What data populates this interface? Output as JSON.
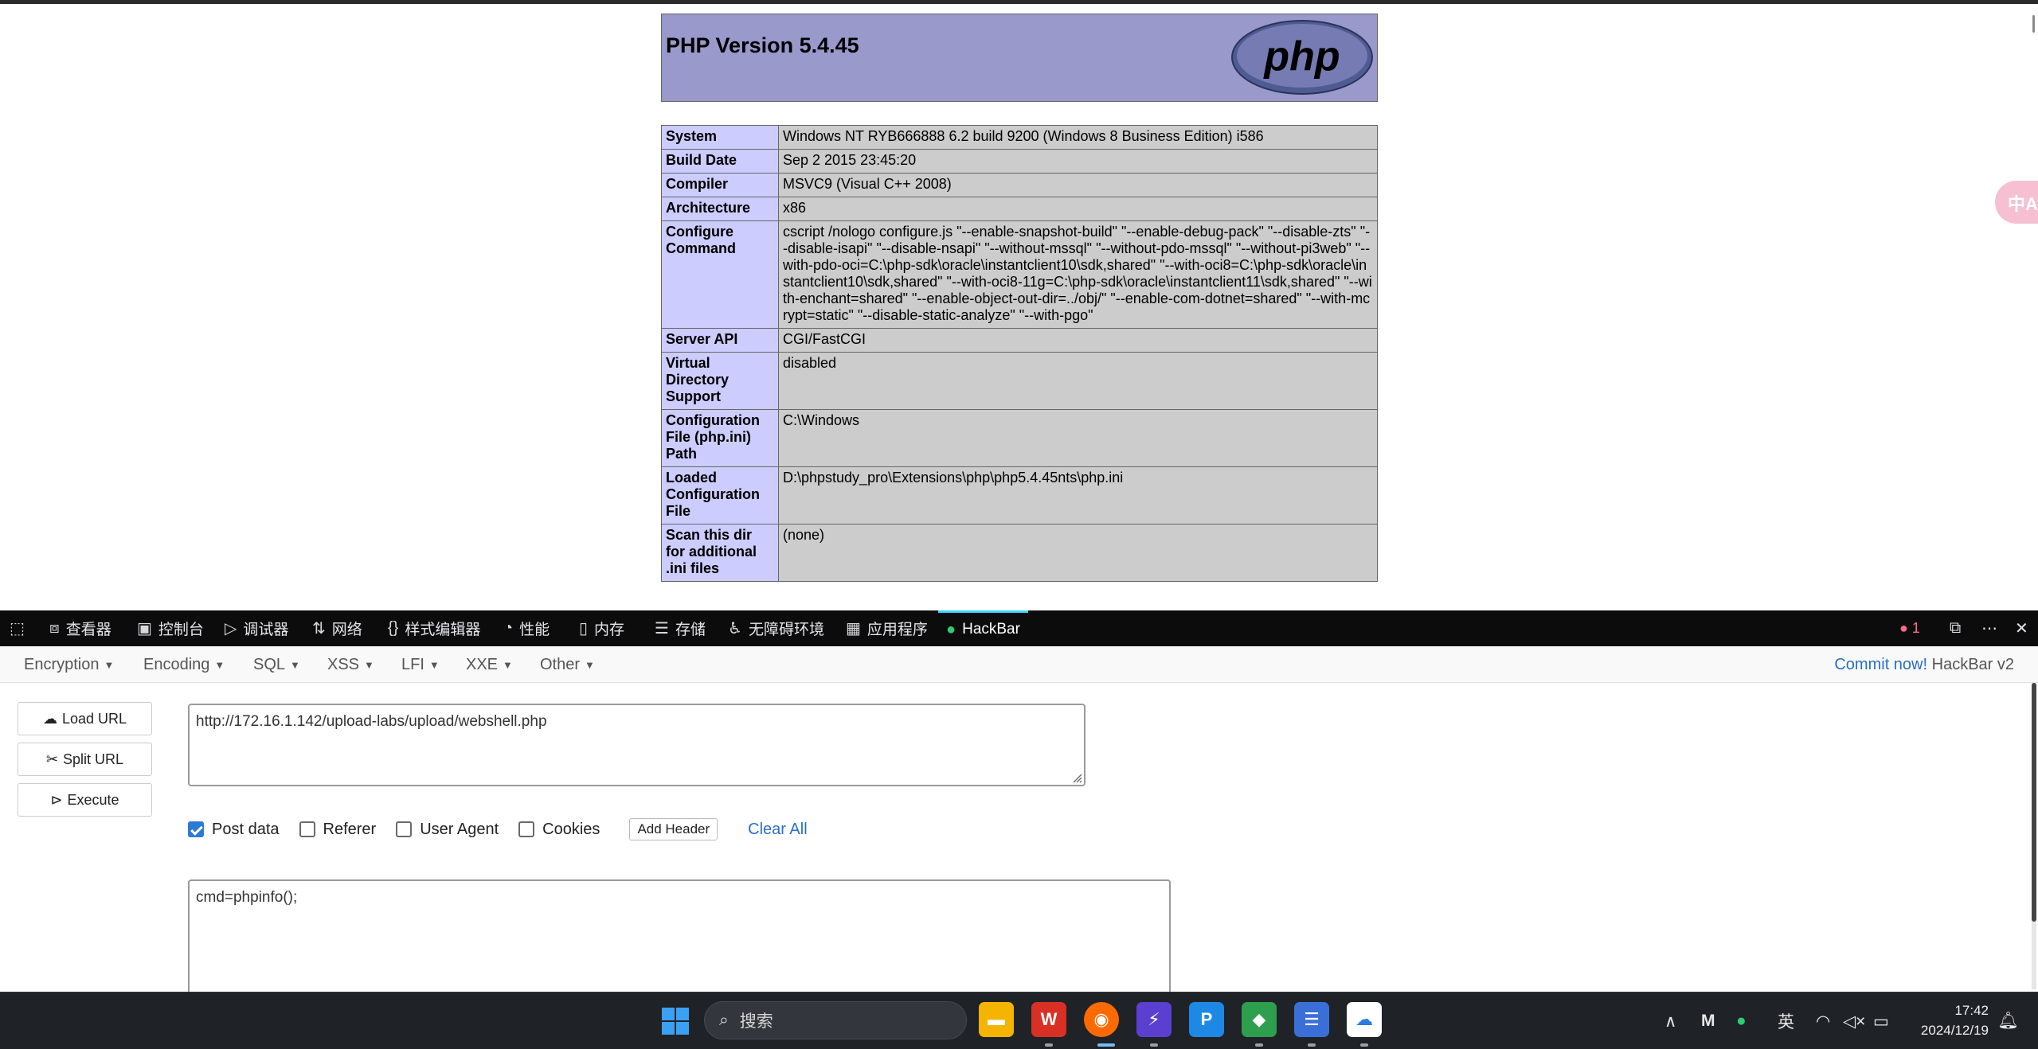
{
  "php": {
    "title": "PHP Version 5.4.45",
    "logo_text": "php",
    "rows": [
      {
        "label": "System",
        "value": "Windows NT RYB666888 6.2 build 9200 (Windows 8 Business Edition) i586"
      },
      {
        "label": "Build Date",
        "value": "Sep 2 2015 23:45:20"
      },
      {
        "label": "Compiler",
        "value": "MSVC9 (Visual C++ 2008)"
      },
      {
        "label": "Architecture",
        "value": "x86"
      },
      {
        "label": "Configure Command",
        "value": "cscript /nologo configure.js \"--enable-snapshot-build\" \"--enable-debug-pack\" \"--disable-zts\" \"--disable-isapi\" \"--disable-nsapi\" \"--without-mssql\" \"--without-pdo-mssql\" \"--without-pi3web\" \"--with-pdo-oci=C:\\php-sdk\\oracle\\instantclient10\\sdk,shared\" \"--with-oci8=C:\\php-sdk\\oracle\\instantclient10\\sdk,shared\" \"--with-oci8-11g=C:\\php-sdk\\oracle\\instantclient11\\sdk,shared\" \"--with-enchant=shared\" \"--enable-object-out-dir=../obj/\" \"--enable-com-dotnet=shared\" \"--with-mcrypt=static\" \"--disable-static-analyze\" \"--with-pgo\""
      },
      {
        "label": "Server API",
        "value": "CGI/FastCGI"
      },
      {
        "label": "Virtual Directory Support",
        "value": "disabled"
      },
      {
        "label": "Configuration File (php.ini) Path",
        "value": "C:\\Windows"
      },
      {
        "label": "Loaded Configuration File",
        "value": "D:\\phpstudy_pro\\Extensions\\php\\php5.4.45nts\\php.ini"
      },
      {
        "label": "Scan this dir for additional .ini files",
        "value": "(none)"
      }
    ]
  },
  "translate_icon": "translate-icon",
  "devtools": {
    "tabs": [
      {
        "label": "查看器",
        "icon": "inspector-icon"
      },
      {
        "label": "控制台",
        "icon": "console-icon"
      },
      {
        "label": "调试器",
        "icon": "debugger-icon"
      },
      {
        "label": "网络",
        "icon": "network-icon"
      },
      {
        "label": "样式编辑器",
        "icon": "style-editor-icon"
      },
      {
        "label": "性能",
        "icon": "performance-icon"
      },
      {
        "label": "内存",
        "icon": "memory-icon"
      },
      {
        "label": "存储",
        "icon": "storage-icon"
      },
      {
        "label": "无障碍环境",
        "icon": "accessibility-icon"
      },
      {
        "label": "应用程序",
        "icon": "application-icon"
      },
      {
        "label": "HackBar",
        "icon": "hackbar-icon"
      }
    ],
    "error_count": "1",
    "accent_color": "#3cd2ff"
  },
  "hackbar": {
    "menus": [
      "Encryption",
      "Encoding",
      "SQL",
      "XSS",
      "LFI",
      "XXE",
      "Other"
    ],
    "commit_link": "Commit now!",
    "version": "HackBar v2",
    "buttons": {
      "load": "Load URL",
      "split": "Split URL",
      "execute": "Execute"
    },
    "url": "http://172.16.1.142/upload-labs/upload/webshell.php",
    "options": {
      "post_data": "Post data",
      "referer": "Referer",
      "user_agent": "User Agent",
      "cookies": "Cookies",
      "post_data_checked": true,
      "referer_checked": false,
      "user_agent_checked": false,
      "cookies_checked": false
    },
    "add_header": "Add Header",
    "clear_all": "Clear All",
    "post_body": "cmd=phpinfo();"
  },
  "taskbar": {
    "search_placeholder": "搜索",
    "apps": [
      "start-button",
      "file-explorer",
      "wps-office",
      "firefox",
      "lightning-app",
      "p-app",
      "android-app",
      "notepad",
      "cloud-app"
    ],
    "ime": "英",
    "time": "17:42",
    "date": "2024/12/19"
  }
}
